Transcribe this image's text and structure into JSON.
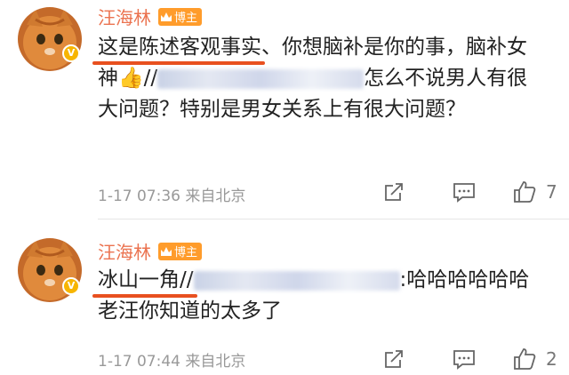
{
  "comments": [
    {
      "username": "汪海林",
      "badge": "博主",
      "text_hl": "这是陈述客观事实",
      "text_rest": "、你想脑补是你的事，脑补女神",
      "text_tail": "怎么不说男人有很大问题？特别是男女关系上有很大问题？",
      "meta": "1-17 07:36  来自北京",
      "likes": "7"
    },
    {
      "username": "汪海林",
      "badge": "博主",
      "text_hl": "冰山一角//",
      "text_tail": ":哈哈哈哈哈哈老汪你知道的太多了",
      "meta": "1-17 07:44  来自北京",
      "likes": "2"
    }
  ],
  "icons": [
    "orange-cat-avatar",
    "verified-v-badge",
    "crown-icon",
    "thumbs-up-emoji",
    "share-icon",
    "comment-icon",
    "like-icon"
  ],
  "colors": {
    "username": "#eb7350",
    "badge": "#ff9c2b",
    "underline": "#e8501f",
    "meta": "#999999"
  }
}
